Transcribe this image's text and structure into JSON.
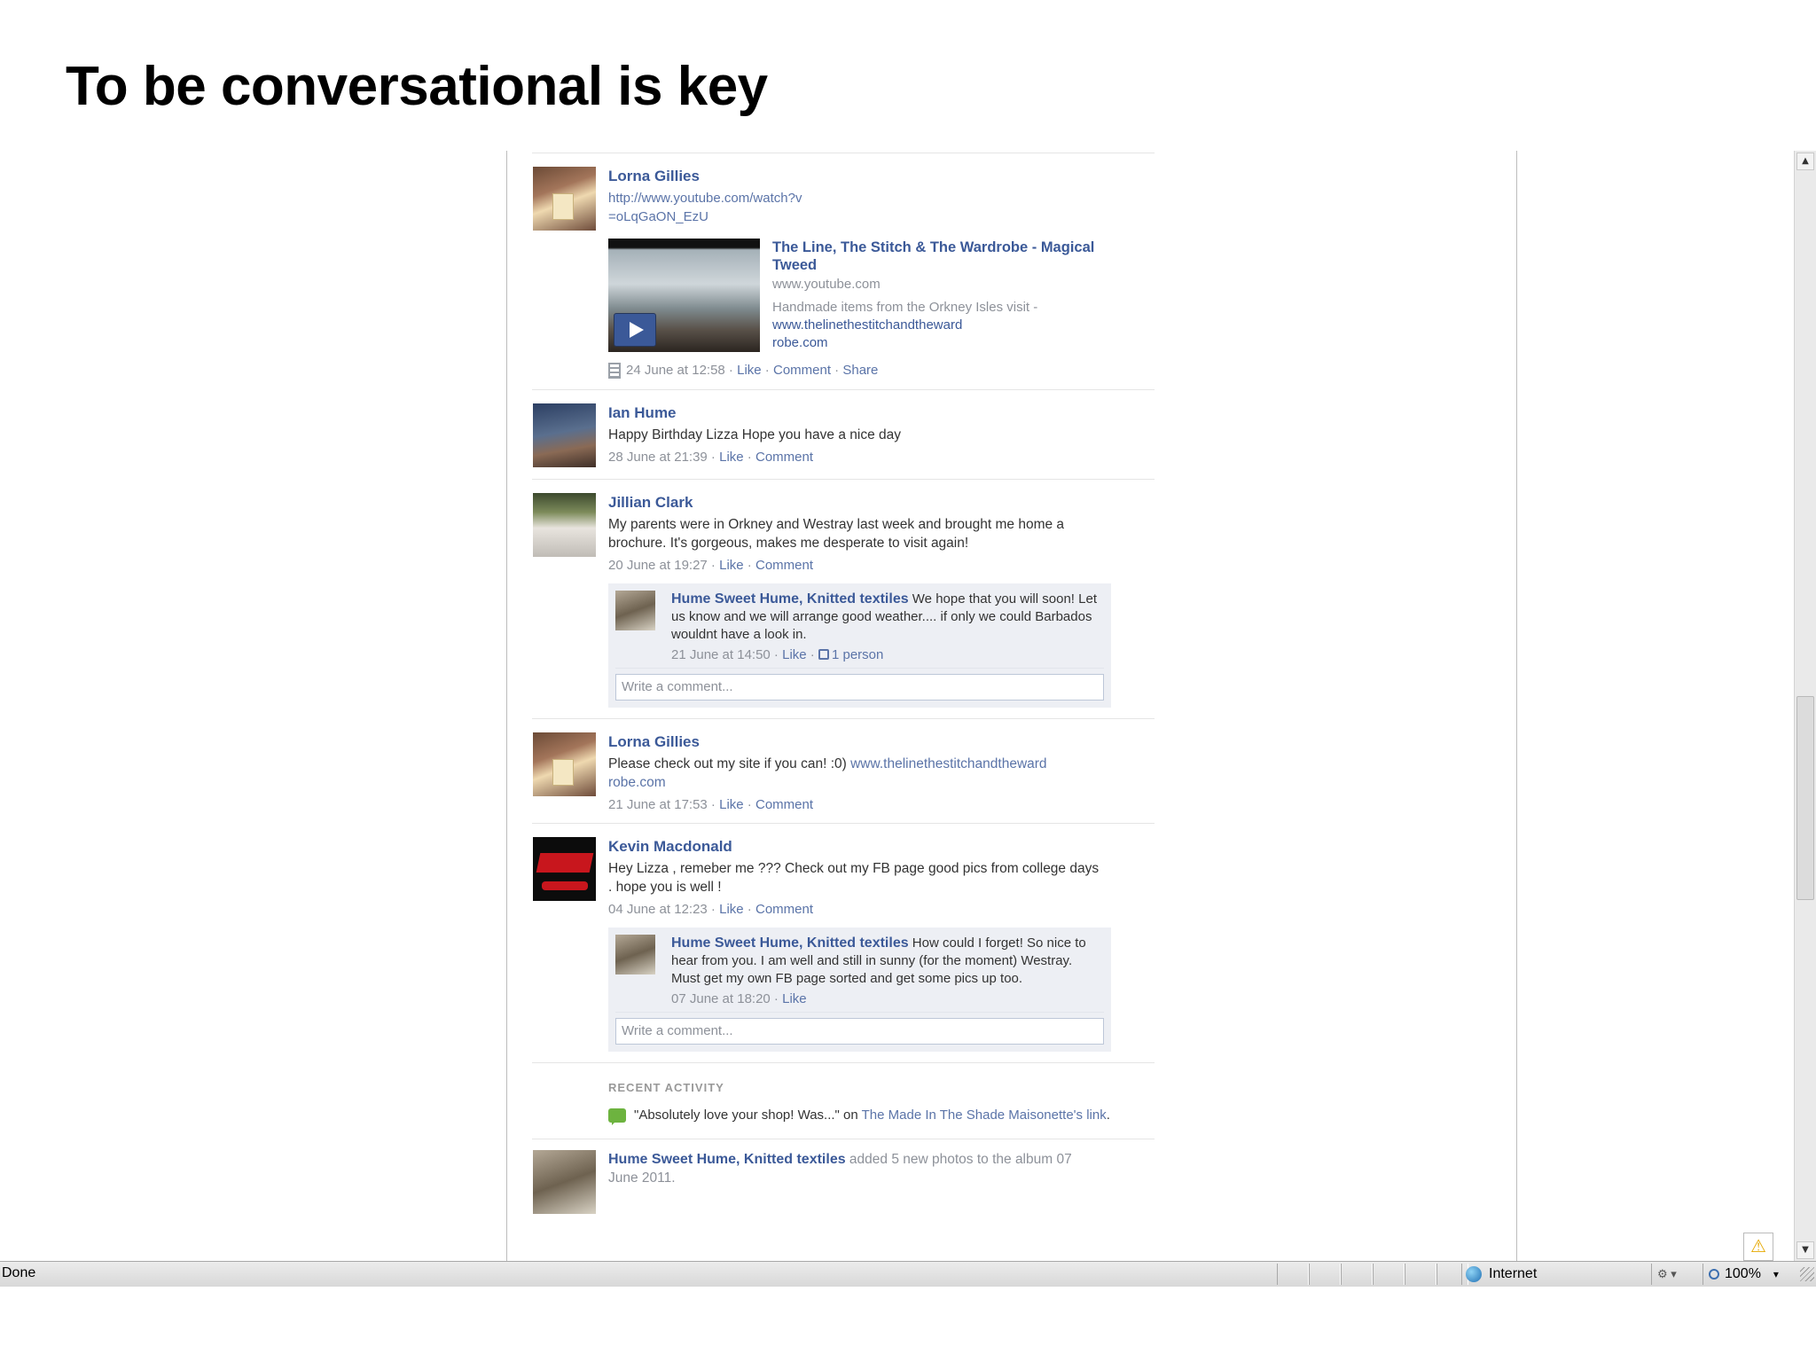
{
  "slide": {
    "title": "To be conversational is key"
  },
  "feed": {
    "post1": {
      "author": "Lorna Gillies",
      "text_line1": "http://www.youtube.com/watch?v",
      "text_line2": "=oLqGaON_EzU",
      "attachment": {
        "title": "The Line, The Stitch & The Wardrobe - Magical Tweed",
        "domain": "www.youtube.com",
        "desc_text": "Handmade items from the Orkney Isles visit - ",
        "desc_link1": "www.thelinethestitchandtheward",
        "desc_link2": "robe.com"
      },
      "time": "24 June at 12:58",
      "actions": [
        "Like",
        "Comment",
        "Share"
      ]
    },
    "post2": {
      "author": "Ian Hume",
      "text": "Happy Birthday Lizza Hope you have a nice day",
      "time": "28 June at 21:39",
      "actions": [
        "Like",
        "Comment"
      ]
    },
    "post3": {
      "author": "Jillian Clark",
      "text": "My parents were in Orkney and Westray last week and brought me home a brochure. It's gorgeous, makes me desperate to visit again!",
      "time": "20 June at 19:27",
      "actions": [
        "Like",
        "Comment"
      ],
      "comment": {
        "author": "Hume Sweet Hume, Knitted textiles",
        "text": "We hope that you will soon! Let us know and we will arrange good weather.... if only we could Barbados wouldnt have a look in.",
        "time": "21 June at 14:50",
        "like": "Like",
        "likes_count": "1 person"
      },
      "write_placeholder": "Write a comment..."
    },
    "post4": {
      "author": "Lorna Gillies",
      "text": "Please check out my site if you can! :0) ",
      "link": "www.thelinethestitchandtheward robe.com",
      "time": "21 June at 17:53",
      "actions": [
        "Like",
        "Comment"
      ]
    },
    "post5": {
      "author": "Kevin Macdonald",
      "text": "Hey Lizza , remeber me ??? Check out my FB page good pics from college days . hope you is well !",
      "time": "04 June at 12:23",
      "actions": [
        "Like",
        "Comment"
      ],
      "comment": {
        "author": "Hume Sweet Hume, Knitted textiles",
        "text": "How could I forget! So nice to hear from you. I am well and still in sunny (for the moment) Westray. Must get my own FB page sorted and get some pics up too.",
        "time": "07 June at 18:20",
        "like": "Like"
      },
      "write_placeholder": "Write a comment..."
    },
    "recent": {
      "label": "RECENT ACTIVITY",
      "quote": "\"Absolutely love your shop! Was...\" on ",
      "link": "The Made In The Shade Maisonette's link",
      "end": "."
    },
    "post6": {
      "author": "Hume Sweet Hume, Knitted textiles",
      "text": " added 5 new photos to the album 07 June 2011."
    }
  },
  "statusbar": {
    "status": "Done",
    "zone": "Internet",
    "zoom": "100%"
  },
  "icons": {
    "scroll_up": "scroll-up-arrow-icon",
    "scroll_down": "scroll-down-arrow-icon",
    "warning": "warning-icon",
    "globe": "globe-icon"
  },
  "colors": {
    "fb_blue": "#3b5998",
    "meta_grey": "#8d9199"
  }
}
